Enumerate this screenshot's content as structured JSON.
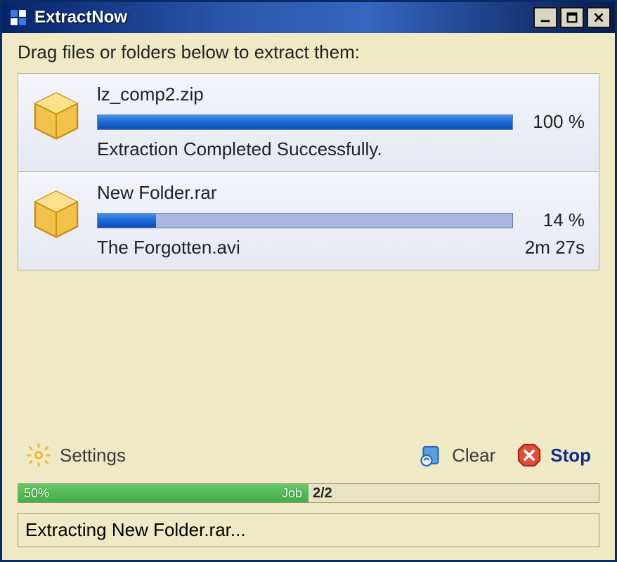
{
  "window": {
    "title": "ExtractNow"
  },
  "main": {
    "instructions": "Drag files or folders below to extract them:"
  },
  "files": [
    {
      "name": "lz_comp2.zip",
      "percent_label": "100 %",
      "percent_value": 100,
      "status": "Extraction Completed Successfully.",
      "time": ""
    },
    {
      "name": "New Folder.rar",
      "percent_label": "14 %",
      "percent_value": 14,
      "status": "The Forgotten.avi",
      "time": "2m 27s"
    }
  ],
  "toolbar": {
    "settings_label": "Settings",
    "clear_label": "Clear",
    "stop_label": "Stop"
  },
  "overall": {
    "percent_label": "50%",
    "percent_value": 50,
    "job_label": "Job",
    "job_count": "2/2"
  },
  "statusbar": {
    "text": "Extracting New Folder.rar..."
  }
}
